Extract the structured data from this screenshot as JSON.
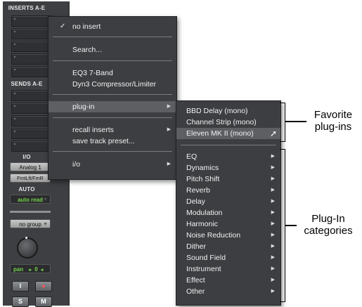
{
  "strip": {
    "inserts_title": "INSERTS A-E",
    "sends_title": "SENDS A-E",
    "io_title": "I/O",
    "io_input": "Analog 1",
    "io_output": "FrntLft/FrnR",
    "auto_title": "AUTO",
    "auto_mode": "auto read",
    "group": "no group",
    "pan_label": "pan",
    "pan_value": "0",
    "insert_button": "I",
    "solo_button": "S",
    "mute_button": "M"
  },
  "main_menu": {
    "check_mark": "✓",
    "items": {
      "no_insert": "no insert",
      "search": "Search...",
      "eq3": "EQ3 7-Band",
      "dyn3": "Dyn3 Compressor/Limiter",
      "plugin": "plug-in",
      "recall": "recall inserts",
      "save_preset": "save track preset...",
      "io": "i/o"
    }
  },
  "favorites_menu": {
    "items": [
      "BBD Delay (mono)",
      "Channel Strip (mono)",
      "Eleven MK II (mono)"
    ]
  },
  "categories_menu": {
    "items": [
      "EQ",
      "Dynamics",
      "Pitch Shift",
      "Reverb",
      "Delay",
      "Modulation",
      "Harmonic",
      "Noise Reduction",
      "Dither",
      "Sound Field",
      "Instrument",
      "Effect",
      "Other"
    ]
  },
  "callouts": {
    "favorites_line1": "Favorite",
    "favorites_line2": "plug-ins",
    "categories_line1": "Plug-In",
    "categories_line2": "categories"
  },
  "colors": {
    "strip_bg": "#3d3f42",
    "menu_bg": "#3d3e41",
    "highlight": "#5d5f63",
    "auto_read_green": "#74d44a"
  }
}
